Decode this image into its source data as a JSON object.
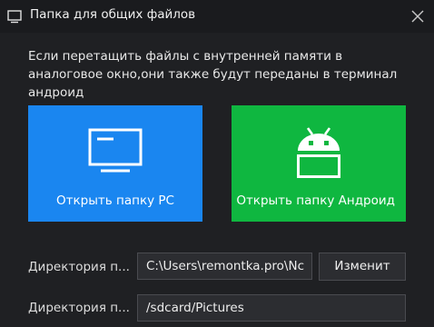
{
  "window": {
    "title": "Папка для общих файлов"
  },
  "description": "Если перетащить файлы с внутренней памяти в аналоговое окно,они также будут переданы в терминал андроид",
  "tiles": {
    "pc": {
      "label": "Открыть папку PC",
      "color": "#1a86f0",
      "icon": "monitor-icon"
    },
    "android": {
      "label": "Открыть папку Андроид",
      "color": "#0fb740",
      "icon": "android-icon"
    }
  },
  "pc_directory": {
    "label": "Директория п...",
    "value": "C:\\Users\\remontka.pro\\Nc",
    "button": "Изменит"
  },
  "android_directory": {
    "label": "Директория п...",
    "value": "/sdcard/Pictures"
  }
}
